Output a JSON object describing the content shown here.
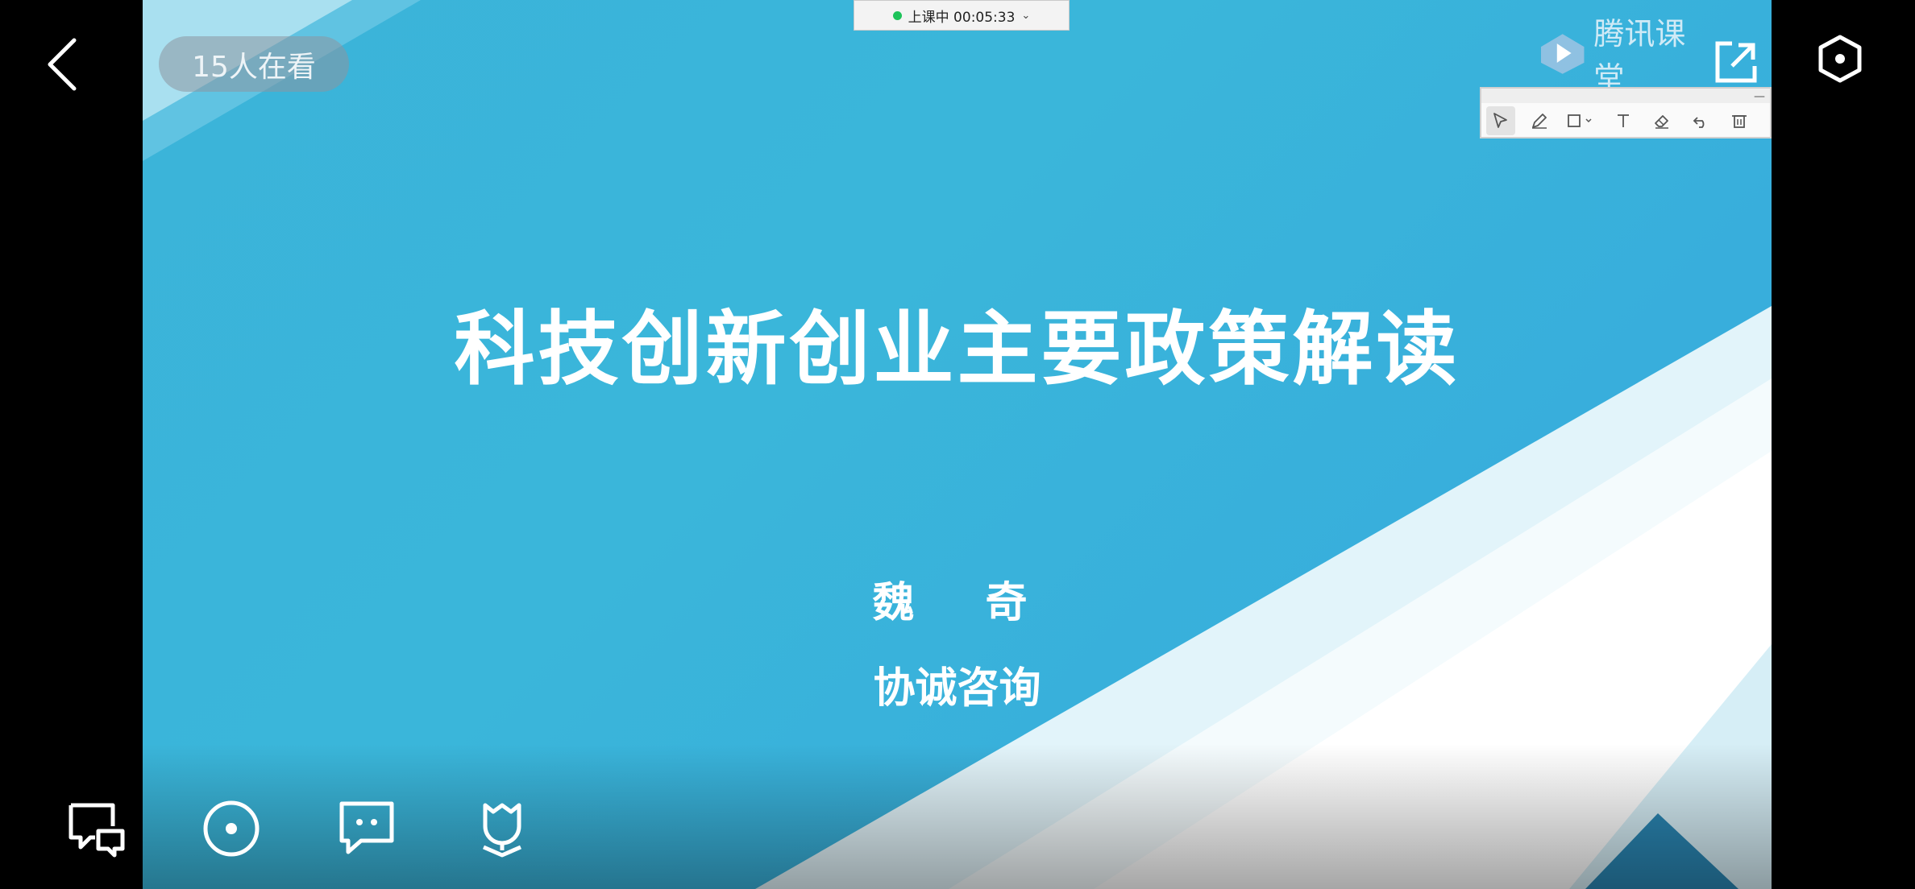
{
  "status": {
    "text": "上课中 00:05:33",
    "dot_color": "#1ec35a"
  },
  "viewer_badge": "15人在看",
  "brand": {
    "name": "腾讯课堂"
  },
  "slide": {
    "title": "科技创新创业主要政策解读",
    "presenter": "魏　奇",
    "organization": "协诚咨询",
    "colors": {
      "primary": "#3ab6da",
      "light": "#e9f7fb"
    }
  },
  "toolbar": {
    "tools": [
      {
        "name": "select-tool",
        "icon": "cursor-icon"
      },
      {
        "name": "pen-tool",
        "icon": "pen-icon"
      },
      {
        "name": "shape-tool",
        "icon": "rectangle-icon"
      },
      {
        "name": "text-tool",
        "icon": "text-icon"
      },
      {
        "name": "eraser-tool",
        "icon": "eraser-icon"
      },
      {
        "name": "undo-tool",
        "icon": "undo-icon"
      },
      {
        "name": "delete-tool",
        "icon": "trash-icon"
      }
    ]
  },
  "bottom_bar": {
    "icons": [
      "danmaku-icon",
      "record-icon",
      "chat-icon",
      "flower-icon"
    ]
  }
}
